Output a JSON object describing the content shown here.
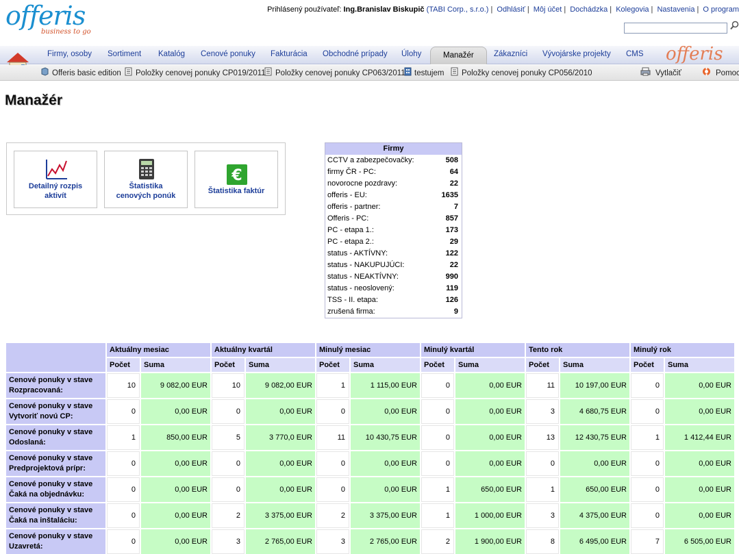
{
  "logo": {
    "word": "offeris",
    "tagline": "business to go"
  },
  "user": {
    "label": "Prihlásený používateľ:",
    "name": "Ing.Branislav Biskupič",
    "company": "(TABI Corp., s.r.o.)",
    "links": [
      "Odhlásiť",
      "Môj účet",
      "Dochádzka",
      "Kolegovia",
      "Nastavenia",
      "O program"
    ]
  },
  "search": {
    "placeholder": ""
  },
  "nav": {
    "tabs": [
      "Firmy, osoby",
      "Sortiment",
      "Katalóg",
      "Cenové ponuky",
      "Fakturácia",
      "Obchodné prípady",
      "Úlohy",
      "Manažér",
      "Zákazníci",
      "Vývojárske projekty",
      "CMS"
    ],
    "active": "Manažér",
    "logo": "offeris"
  },
  "subbar": {
    "items": [
      "Offeris basic edition",
      "Položky cenovej ponuky CP019/2011",
      "Položky cenovej ponuky CP063/2011",
      "testujem",
      "Položky cenovej ponuky CP056/2010"
    ],
    "print": "Vytlačiť",
    "help": "Pomoc"
  },
  "page": {
    "title": "Manažér"
  },
  "widgets": [
    {
      "line1": "Detailný rozpis",
      "line2": "aktivít",
      "icon": "chart-line-icon"
    },
    {
      "line1": "Štatistika",
      "line2": "cenových ponúk",
      "icon": "calculator-icon"
    },
    {
      "line1": "Štatistika faktúr",
      "line2": "",
      "icon": "euro-icon"
    }
  ],
  "firmy": {
    "title": "Firmy",
    "rows": [
      {
        "name": "CCTV a zabezpečovačky:",
        "value": "508"
      },
      {
        "name": "firmy ČR - PC:",
        "value": "64"
      },
      {
        "name": "novorocne pozdravy:",
        "value": "22"
      },
      {
        "name": "offeris - EU:",
        "value": "1635"
      },
      {
        "name": "offeris - partner:",
        "value": "7"
      },
      {
        "name": "Offeris - PC:",
        "value": "857"
      },
      {
        "name": "PC - etapa 1.:",
        "value": "173"
      },
      {
        "name": "PC - etapa 2.:",
        "value": "29"
      },
      {
        "name": "status - AKTÍVNY:",
        "value": "122"
      },
      {
        "name": "status - NAKUPUJÚCI:",
        "value": "22"
      },
      {
        "name": "status - NEAKTÍVNY:",
        "value": "990"
      },
      {
        "name": "status - neoslovený:",
        "value": "119"
      },
      {
        "name": "TSS - II. etapa:",
        "value": "126"
      },
      {
        "name": "zrušená firma:",
        "value": "9"
      }
    ]
  },
  "stats": {
    "periods": [
      "Aktuálny mesiac",
      "Aktuálny kvartál",
      "Minulý mesiac",
      "Minulý kvartál",
      "Tento rok",
      "Minulý rok"
    ],
    "count_label": "Počet",
    "sum_label": "Suma",
    "rows": [
      {
        "label1": "Cenové ponuky v stave",
        "label2": "Rozpracovaná:",
        "cells": [
          [
            "10",
            "9 082,00 EUR"
          ],
          [
            "10",
            "9 082,00 EUR"
          ],
          [
            "1",
            "1 115,00 EUR"
          ],
          [
            "0",
            "0,00 EUR"
          ],
          [
            "11",
            "10 197,00 EUR"
          ],
          [
            "0",
            "0,00 EUR"
          ]
        ]
      },
      {
        "label1": "Cenové ponuky v stave",
        "label2": "Vytvoriť novú CP:",
        "cells": [
          [
            "0",
            "0,00 EUR"
          ],
          [
            "0",
            "0,00 EUR"
          ],
          [
            "0",
            "0,00 EUR"
          ],
          [
            "0",
            "0,00 EUR"
          ],
          [
            "3",
            "4 680,75 EUR"
          ],
          [
            "0",
            "0,00 EUR"
          ]
        ]
      },
      {
        "label1": "Cenové ponuky v stave",
        "label2": "Odoslaná:",
        "cells": [
          [
            "1",
            "850,00 EUR"
          ],
          [
            "5",
            "3 770,0 EUR"
          ],
          [
            "11",
            "10 430,75 EUR"
          ],
          [
            "0",
            "0,00 EUR"
          ],
          [
            "13",
            "12 430,75 EUR"
          ],
          [
            "1",
            "1 412,44 EUR"
          ]
        ]
      },
      {
        "label1": "Cenové ponuky v stave",
        "label2": "Predprojektová prípr:",
        "cells": [
          [
            "0",
            "0,00 EUR"
          ],
          [
            "0",
            "0,00 EUR"
          ],
          [
            "0",
            "0,00 EUR"
          ],
          [
            "0",
            "0,00 EUR"
          ],
          [
            "0",
            "0,00 EUR"
          ],
          [
            "0",
            "0,00 EUR"
          ]
        ]
      },
      {
        "label1": "Cenové ponuky v stave",
        "label2": "Čaká na objednávku:",
        "cells": [
          [
            "0",
            "0,00 EUR"
          ],
          [
            "0",
            "0,00 EUR"
          ],
          [
            "0",
            "0,00 EUR"
          ],
          [
            "1",
            "650,00 EUR"
          ],
          [
            "1",
            "650,00 EUR"
          ],
          [
            "0",
            "0,00 EUR"
          ]
        ]
      },
      {
        "label1": "Cenové ponuky v stave",
        "label2": "Čaká na inštaláciu:",
        "cells": [
          [
            "0",
            "0,00 EUR"
          ],
          [
            "2",
            "3 375,00 EUR"
          ],
          [
            "2",
            "3 375,00 EUR"
          ],
          [
            "1",
            "1 000,00 EUR"
          ],
          [
            "3",
            "4 375,00 EUR"
          ],
          [
            "0",
            "0,00 EUR"
          ]
        ]
      },
      {
        "label1": "Cenové ponuky v stave",
        "label2": "Uzavretá:",
        "cells": [
          [
            "0",
            "0,00 EUR"
          ],
          [
            "3",
            "2 765,00 EUR"
          ],
          [
            "3",
            "2 765,00 EUR"
          ],
          [
            "2",
            "1 900,00 EUR"
          ],
          [
            "8",
            "6 495,00 EUR"
          ],
          [
            "7",
            "6 505,00 EUR"
          ]
        ]
      }
    ]
  },
  "colors": {
    "link": "#1c3d99",
    "header_bg": "#c8c9f5",
    "sum_bg": "#c6fcc5",
    "logo_blue": "#1b8fd0",
    "logo_orange": "#e36b3a"
  }
}
